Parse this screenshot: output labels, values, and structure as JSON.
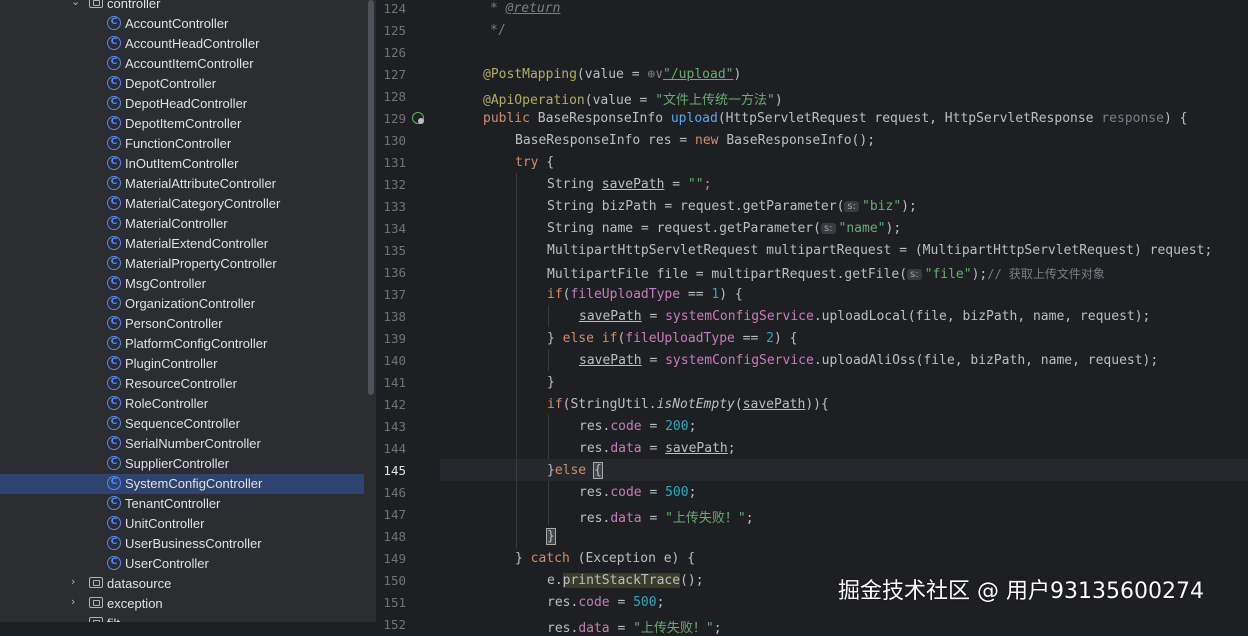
{
  "project_tree": {
    "controller_folder": "controller",
    "items": [
      "AccountController",
      "AccountHeadController",
      "AccountItemController",
      "DepotController",
      "DepotHeadController",
      "DepotItemController",
      "FunctionController",
      "InOutItemController",
      "MaterialAttributeController",
      "MaterialCategoryController",
      "MaterialController",
      "MaterialExtendController",
      "MaterialPropertyController",
      "MsgController",
      "OrganizationController",
      "PersonController",
      "PlatformConfigController",
      "PluginController",
      "ResourceController",
      "RoleController",
      "SequenceController",
      "SerialNumberController",
      "SupplierController",
      "SystemConfigController",
      "TenantController",
      "UnitController",
      "UserBusinessController",
      "UserController"
    ],
    "selected": "SystemConfigController",
    "folders_below": [
      "datasource",
      "exception"
    ],
    "partial_folder": "filt",
    "class_icon_glyph": "C"
  },
  "editor": {
    "current_line": "145",
    "line_numbers": [
      "124",
      "125",
      "126",
      "127",
      "128",
      "129",
      "130",
      "131",
      "132",
      "133",
      "134",
      "135",
      "136",
      "137",
      "138",
      "139",
      "140",
      "141",
      "142",
      "143",
      "144",
      "145",
      "146",
      "147",
      "148",
      "149",
      "150",
      "151",
      "152"
    ],
    "code": {
      "l124_star": "* ",
      "l124_tag": "@return",
      "l125": "*/",
      "l127_ann": "@PostMapping",
      "l127_a": "(value = ",
      "l127_hint": "⊕∨",
      "l127_str": "\"/upload\"",
      "l127_b": ")",
      "l128_ann": "@ApiOperation",
      "l128_a": "(value = ",
      "l128_str": "\"文件上传统一方法\"",
      "l128_b": ")",
      "l129_kw": "public",
      "l129_a": " BaseResponseInfo ",
      "l129_fn": "upload",
      "l129_b": "(HttpServletRequest request, HttpServletResponse ",
      "l129_unused": "response",
      "l129_c": ") {",
      "l130_a": "BaseResponseInfo res = ",
      "l130_kw": "new",
      "l130_b": " BaseResponseInfo();",
      "l131_kw": "try",
      "l131_a": " {",
      "l132_a": "String ",
      "l132_var": "savePath",
      "l132_b": " = ",
      "l132_str": "\"\"",
      "l132_c": ";",
      "l133_a": "String bizPath = request.getParameter(",
      "l133_hint": "s:",
      "l133_str": "\"biz\"",
      "l133_b": ");",
      "l134_a": "String name = request.getParameter(",
      "l134_hint": "s:",
      "l134_str": "\"name\"",
      "l134_b": ");",
      "l135": "MultipartHttpServletRequest multipartRequest = (MultipartHttpServletRequest) request;",
      "l136_a": "MultipartFile file = multipartRequest.getFile(",
      "l136_hint": "s:",
      "l136_str": "\"file\"",
      "l136_b": ");",
      "l136_cm": "// 获取上传文件对象",
      "l137_kw": "if",
      "l137_a": "(",
      "l137_fld": "fileUploadType",
      "l137_b": " == ",
      "l137_num": "1",
      "l137_c": ") {",
      "l138_var": "savePath",
      "l138_a": " = ",
      "l138_fld": "systemConfigService",
      "l138_b": ".uploadLocal(file, bizPath, name, request);",
      "l139_a": "} ",
      "l139_kw": "else if",
      "l139_b": "(",
      "l139_fld": "fileUploadType",
      "l139_c": " == ",
      "l139_num": "2",
      "l139_d": ") {",
      "l140_var": "savePath",
      "l140_a": " = ",
      "l140_fld": "systemConfigService",
      "l140_b": ".uploadAliOss(file, bizPath, name, request);",
      "l141": "}",
      "l142_kw": "if",
      "l142_a": "(StringUtil.",
      "l142_fn": "isNotEmpty",
      "l142_b": "(",
      "l142_var": "savePath",
      "l142_c": ")){",
      "l143_a": "res.",
      "l143_fld": "code",
      "l143_b": " = ",
      "l143_num": "200",
      "l143_c": ";",
      "l144_a": "res.",
      "l144_fld": "data",
      "l144_b": " = ",
      "l144_var": "savePath",
      "l144_c": ";",
      "l145_a": "}",
      "l145_kw": "else",
      "l145_b": " ",
      "l145_brace": "{",
      "l146_a": "res.",
      "l146_fld": "code",
      "l146_b": " = ",
      "l146_num": "500",
      "l146_c": ";",
      "l147_a": "res.",
      "l147_fld": "data",
      "l147_b": " = ",
      "l147_str": "\"上传失败！\"",
      "l147_c": ";",
      "l148": "}",
      "l149_a": "} ",
      "l149_kw": "catch",
      "l149_b": " (Exception e) {",
      "l150_a": "e.",
      "l150_fn": "printStackTrace",
      "l150_b": "();",
      "l151_a": "res.",
      "l151_fld": "code",
      "l151_b": " = ",
      "l151_num": "500",
      "l151_c": ";",
      "l152_a": "res.",
      "l152_fld": "data",
      "l152_b": " = ",
      "l152_str": "\"上传失败！\"",
      "l152_c": ";"
    }
  },
  "watermark": "掘金技术社区 @ 用户93135600274",
  "colors": {
    "background": "#1e1f22",
    "sidebar": "#2b2d30",
    "selection": "#2e436e",
    "keyword": "#cf8e6d",
    "string": "#6aab73",
    "annotation": "#b3ae60",
    "number": "#2aacb8",
    "field": "#c77dbb",
    "method": "#56a8f5"
  }
}
